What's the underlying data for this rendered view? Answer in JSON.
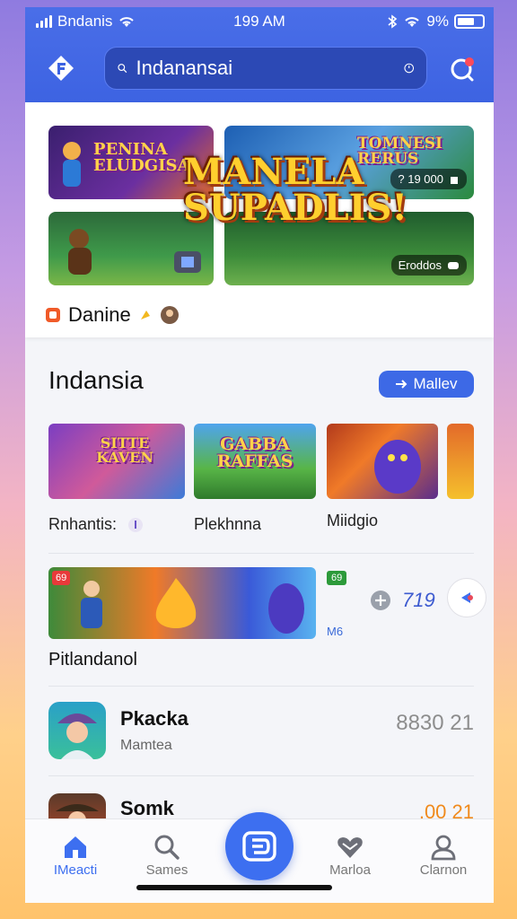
{
  "status_bar": {
    "carrier": "Bndanis",
    "time": "199 AM",
    "battery": "9%"
  },
  "header": {
    "search_value": "Indanansai",
    "logo_icon": "app-logo-icon",
    "accent": "#3d63e2"
  },
  "featured": {
    "tile1_title": "PENINA ELUDGISA",
    "tile2_title": "TOMNESI RERUS",
    "tile2_pill": "? 19 000",
    "tile4_pill": "Eroddos",
    "main_title": "MANELA SUPADLIS!",
    "caption": "Danine"
  },
  "section": {
    "title": "Indansia",
    "more_label": "Mallev",
    "games": [
      {
        "title": "SITTE KAVEN",
        "label": "Rnhantis:"
      },
      {
        "title": "GABBA RAFFAS",
        "label": "Plekhnna"
      },
      {
        "title": "",
        "label": "Miidgio"
      }
    ]
  },
  "promo": {
    "badge_left": "69",
    "badge_right": "69",
    "side_text": "M6",
    "count": "719",
    "label": "Pitlandanol"
  },
  "list": [
    {
      "title": "Pkacka",
      "subtitle": "Mamtea",
      "value": "8830 21"
    },
    {
      "title": "Somk",
      "subtitle": "",
      "value": ".00 21"
    }
  ],
  "nav": {
    "items": [
      {
        "label": "IMeacti",
        "icon": "home-icon"
      },
      {
        "label": "Sames",
        "icon": "search-icon"
      },
      {
        "label": "",
        "icon": "center-app-icon"
      },
      {
        "label": "Marloa",
        "icon": "heart-icon"
      },
      {
        "label": "Clarnon",
        "icon": "profile-icon"
      }
    ]
  }
}
